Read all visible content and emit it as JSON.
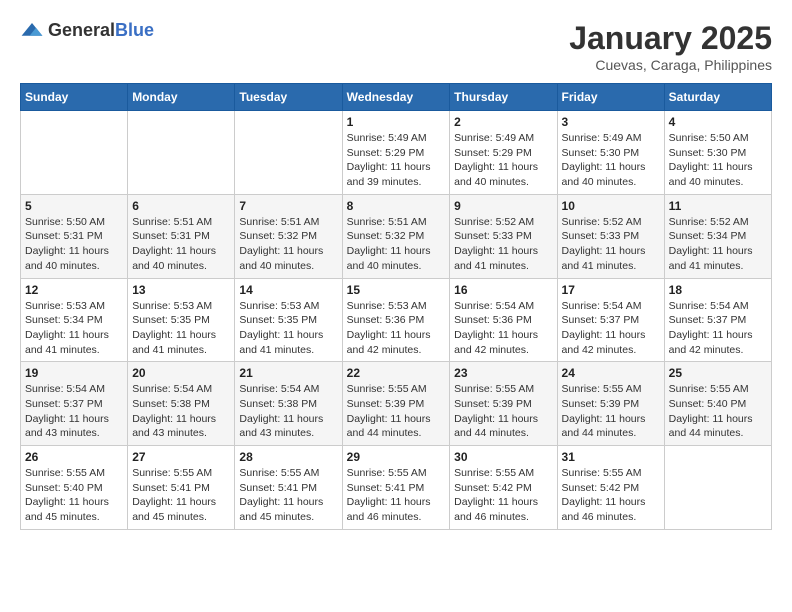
{
  "logo": {
    "general": "General",
    "blue": "Blue"
  },
  "title": "January 2025",
  "subtitle": "Cuevas, Caraga, Philippines",
  "weekdays": [
    "Sunday",
    "Monday",
    "Tuesday",
    "Wednesday",
    "Thursday",
    "Friday",
    "Saturday"
  ],
  "weeks": [
    [
      {
        "day": "",
        "sunrise": "",
        "sunset": "",
        "daylight": ""
      },
      {
        "day": "",
        "sunrise": "",
        "sunset": "",
        "daylight": ""
      },
      {
        "day": "",
        "sunrise": "",
        "sunset": "",
        "daylight": ""
      },
      {
        "day": "1",
        "sunrise": "Sunrise: 5:49 AM",
        "sunset": "Sunset: 5:29 PM",
        "daylight": "Daylight: 11 hours and 39 minutes."
      },
      {
        "day": "2",
        "sunrise": "Sunrise: 5:49 AM",
        "sunset": "Sunset: 5:29 PM",
        "daylight": "Daylight: 11 hours and 40 minutes."
      },
      {
        "day": "3",
        "sunrise": "Sunrise: 5:49 AM",
        "sunset": "Sunset: 5:30 PM",
        "daylight": "Daylight: 11 hours and 40 minutes."
      },
      {
        "day": "4",
        "sunrise": "Sunrise: 5:50 AM",
        "sunset": "Sunset: 5:30 PM",
        "daylight": "Daylight: 11 hours and 40 minutes."
      }
    ],
    [
      {
        "day": "5",
        "sunrise": "Sunrise: 5:50 AM",
        "sunset": "Sunset: 5:31 PM",
        "daylight": "Daylight: 11 hours and 40 minutes."
      },
      {
        "day": "6",
        "sunrise": "Sunrise: 5:51 AM",
        "sunset": "Sunset: 5:31 PM",
        "daylight": "Daylight: 11 hours and 40 minutes."
      },
      {
        "day": "7",
        "sunrise": "Sunrise: 5:51 AM",
        "sunset": "Sunset: 5:32 PM",
        "daylight": "Daylight: 11 hours and 40 minutes."
      },
      {
        "day": "8",
        "sunrise": "Sunrise: 5:51 AM",
        "sunset": "Sunset: 5:32 PM",
        "daylight": "Daylight: 11 hours and 40 minutes."
      },
      {
        "day": "9",
        "sunrise": "Sunrise: 5:52 AM",
        "sunset": "Sunset: 5:33 PM",
        "daylight": "Daylight: 11 hours and 41 minutes."
      },
      {
        "day": "10",
        "sunrise": "Sunrise: 5:52 AM",
        "sunset": "Sunset: 5:33 PM",
        "daylight": "Daylight: 11 hours and 41 minutes."
      },
      {
        "day": "11",
        "sunrise": "Sunrise: 5:52 AM",
        "sunset": "Sunset: 5:34 PM",
        "daylight": "Daylight: 11 hours and 41 minutes."
      }
    ],
    [
      {
        "day": "12",
        "sunrise": "Sunrise: 5:53 AM",
        "sunset": "Sunset: 5:34 PM",
        "daylight": "Daylight: 11 hours and 41 minutes."
      },
      {
        "day": "13",
        "sunrise": "Sunrise: 5:53 AM",
        "sunset": "Sunset: 5:35 PM",
        "daylight": "Daylight: 11 hours and 41 minutes."
      },
      {
        "day": "14",
        "sunrise": "Sunrise: 5:53 AM",
        "sunset": "Sunset: 5:35 PM",
        "daylight": "Daylight: 11 hours and 41 minutes."
      },
      {
        "day": "15",
        "sunrise": "Sunrise: 5:53 AM",
        "sunset": "Sunset: 5:36 PM",
        "daylight": "Daylight: 11 hours and 42 minutes."
      },
      {
        "day": "16",
        "sunrise": "Sunrise: 5:54 AM",
        "sunset": "Sunset: 5:36 PM",
        "daylight": "Daylight: 11 hours and 42 minutes."
      },
      {
        "day": "17",
        "sunrise": "Sunrise: 5:54 AM",
        "sunset": "Sunset: 5:37 PM",
        "daylight": "Daylight: 11 hours and 42 minutes."
      },
      {
        "day": "18",
        "sunrise": "Sunrise: 5:54 AM",
        "sunset": "Sunset: 5:37 PM",
        "daylight": "Daylight: 11 hours and 42 minutes."
      }
    ],
    [
      {
        "day": "19",
        "sunrise": "Sunrise: 5:54 AM",
        "sunset": "Sunset: 5:37 PM",
        "daylight": "Daylight: 11 hours and 43 minutes."
      },
      {
        "day": "20",
        "sunrise": "Sunrise: 5:54 AM",
        "sunset": "Sunset: 5:38 PM",
        "daylight": "Daylight: 11 hours and 43 minutes."
      },
      {
        "day": "21",
        "sunrise": "Sunrise: 5:54 AM",
        "sunset": "Sunset: 5:38 PM",
        "daylight": "Daylight: 11 hours and 43 minutes."
      },
      {
        "day": "22",
        "sunrise": "Sunrise: 5:55 AM",
        "sunset": "Sunset: 5:39 PM",
        "daylight": "Daylight: 11 hours and 44 minutes."
      },
      {
        "day": "23",
        "sunrise": "Sunrise: 5:55 AM",
        "sunset": "Sunset: 5:39 PM",
        "daylight": "Daylight: 11 hours and 44 minutes."
      },
      {
        "day": "24",
        "sunrise": "Sunrise: 5:55 AM",
        "sunset": "Sunset: 5:39 PM",
        "daylight": "Daylight: 11 hours and 44 minutes."
      },
      {
        "day": "25",
        "sunrise": "Sunrise: 5:55 AM",
        "sunset": "Sunset: 5:40 PM",
        "daylight": "Daylight: 11 hours and 44 minutes."
      }
    ],
    [
      {
        "day": "26",
        "sunrise": "Sunrise: 5:55 AM",
        "sunset": "Sunset: 5:40 PM",
        "daylight": "Daylight: 11 hours and 45 minutes."
      },
      {
        "day": "27",
        "sunrise": "Sunrise: 5:55 AM",
        "sunset": "Sunset: 5:41 PM",
        "daylight": "Daylight: 11 hours and 45 minutes."
      },
      {
        "day": "28",
        "sunrise": "Sunrise: 5:55 AM",
        "sunset": "Sunset: 5:41 PM",
        "daylight": "Daylight: 11 hours and 45 minutes."
      },
      {
        "day": "29",
        "sunrise": "Sunrise: 5:55 AM",
        "sunset": "Sunset: 5:41 PM",
        "daylight": "Daylight: 11 hours and 46 minutes."
      },
      {
        "day": "30",
        "sunrise": "Sunrise: 5:55 AM",
        "sunset": "Sunset: 5:42 PM",
        "daylight": "Daylight: 11 hours and 46 minutes."
      },
      {
        "day": "31",
        "sunrise": "Sunrise: 5:55 AM",
        "sunset": "Sunset: 5:42 PM",
        "daylight": "Daylight: 11 hours and 46 minutes."
      },
      {
        "day": "",
        "sunrise": "",
        "sunset": "",
        "daylight": ""
      }
    ]
  ]
}
